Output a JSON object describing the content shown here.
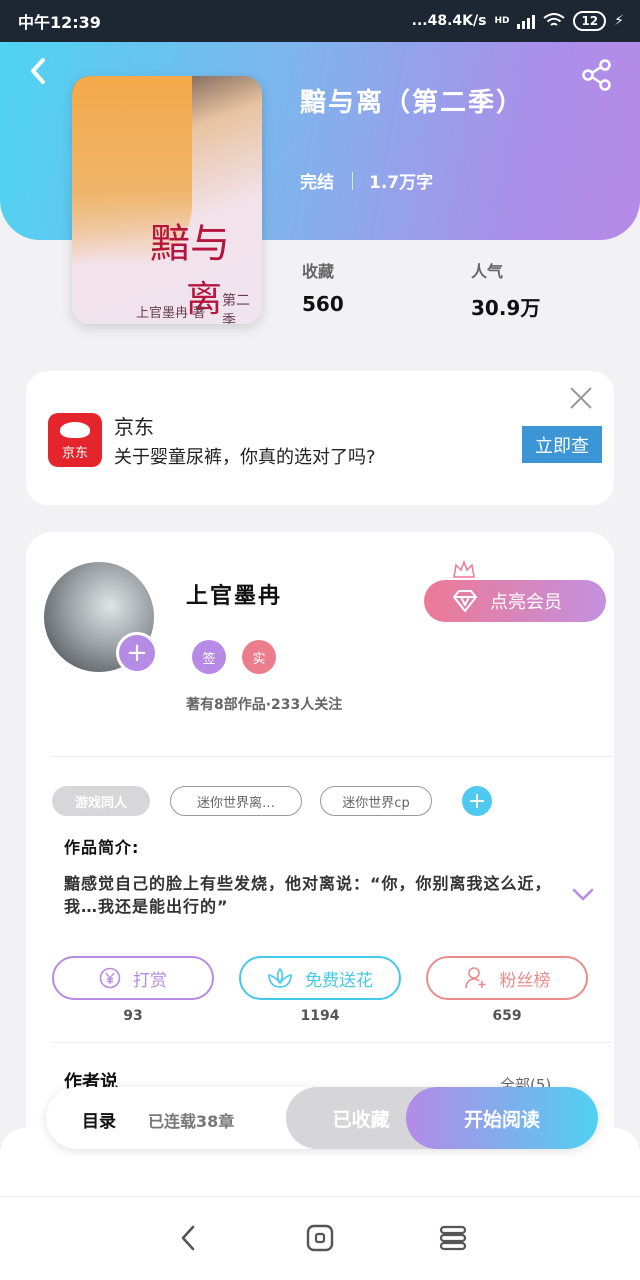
{
  "status_bar": {
    "carrier_time": "中午12:39",
    "net_speed": "...48.4K/s",
    "network": "HD",
    "battery": "12"
  },
  "book": {
    "title": "黯与离（第二季）",
    "status": "完结",
    "word_count": "1.7万字",
    "cover": {
      "title_line1": "黯与",
      "title_line2": "离",
      "season": "第二季",
      "author": "上官墨冉 著"
    },
    "stats": [
      {
        "label": "收藏",
        "value": "560"
      },
      {
        "label": "人气",
        "value": "30.9万"
      }
    ]
  },
  "ad": {
    "brand": "京东",
    "logo_text": "京东",
    "message": "关于婴童尿裤，你真的选对了吗?",
    "cta": "立即查"
  },
  "author": {
    "name": "上官墨冉",
    "badges": [
      "签",
      "实"
    ],
    "info": "著有8部作品·233人关注",
    "vip_button": "点亮会员"
  },
  "tags": [
    "游戏同人",
    "迷你世界离…",
    "迷你世界cp"
  ],
  "intro": {
    "heading": "作品简介:",
    "text": "黯感觉自己的脸上有些发烧，他对离说：“你，你别离我这么近，我…我还是能出行的”"
  },
  "actions": [
    {
      "label": "打赏",
      "icon": "yen-icon",
      "count": "93",
      "color": "#b98ae2"
    },
    {
      "label": "免费送花",
      "icon": "flower-icon",
      "count": "1194",
      "color": "#45c9e9"
    },
    {
      "label": "粉丝榜",
      "icon": "fans-icon",
      "count": "659",
      "color": "#e98c8c"
    }
  ],
  "author_says": {
    "heading": "作者说",
    "all_link": "全部(5)"
  },
  "bottom_bar": {
    "toc": "目录",
    "serial_status": "已连载38章",
    "collected": "已收藏",
    "start_reading": "开始阅读"
  },
  "colors": {
    "header_start": "#4fd4f2",
    "header_end": "#b78ae8",
    "accent_purple": "#b68be6",
    "accent_cyan": "#4fc9ef"
  }
}
